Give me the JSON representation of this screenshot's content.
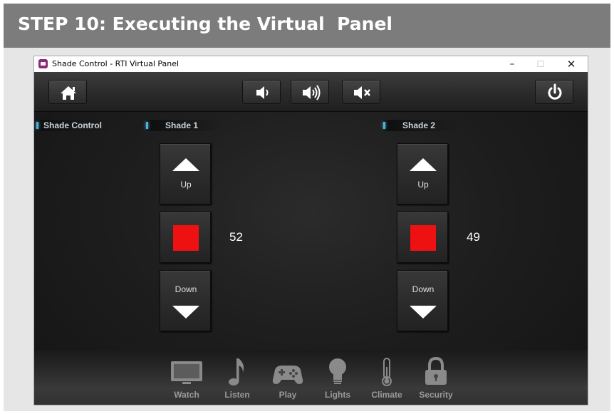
{
  "slide": {
    "step_title": "STEP 10: Executing the Virtual  Panel"
  },
  "window": {
    "title": "Shade Control - RTI Virtual Panel",
    "controls": {
      "minimize": "–",
      "maximize": "☐",
      "close": "✕"
    }
  },
  "topbar": {
    "buttons": [
      {
        "name": "home",
        "icon": "home-icon"
      },
      {
        "name": "volume-down",
        "icon": "speaker-low-icon"
      },
      {
        "name": "volume-up",
        "icon": "speaker-high-icon"
      },
      {
        "name": "mute",
        "icon": "speaker-mute-icon"
      },
      {
        "name": "power",
        "icon": "power-icon"
      }
    ]
  },
  "section_label": "Shade Control",
  "shades": [
    {
      "label": "Shade 1",
      "up_label": "Up",
      "down_label": "Down",
      "position": "52"
    },
    {
      "label": "Shade 2",
      "up_label": "Up",
      "down_label": "Down",
      "position": "49"
    }
  ],
  "dock": {
    "items": [
      {
        "label": "Watch",
        "icon": "tv-icon"
      },
      {
        "label": "Listen",
        "icon": "music-note-icon"
      },
      {
        "label": "Play",
        "icon": "gamepad-icon"
      },
      {
        "label": "Lights",
        "icon": "lightbulb-icon"
      },
      {
        "label": "Climate",
        "icon": "thermometer-icon"
      },
      {
        "label": "Security",
        "icon": "padlock-icon"
      }
    ]
  },
  "colors": {
    "banner": "#7c7c7c",
    "stop": "#ee1111",
    "label_accent": "#4fb3d9",
    "panel_bg": "#1e1e1e"
  }
}
